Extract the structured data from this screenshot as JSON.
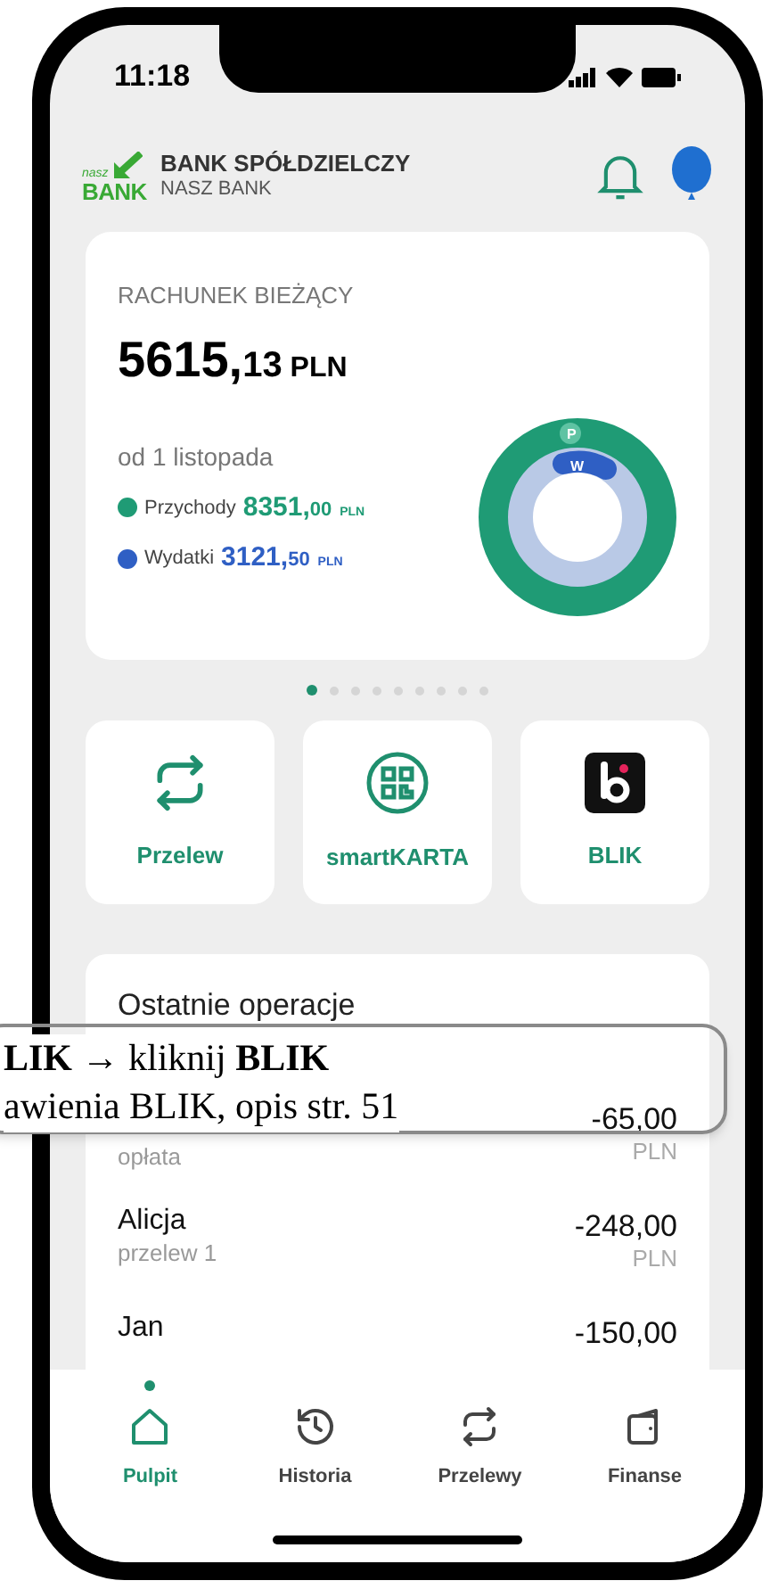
{
  "status_bar": {
    "time": "11:18"
  },
  "header": {
    "bank_logo_small": "nasz",
    "bank_logo_big": "BANK",
    "bank_name": "BANK SPÓŁDZIELCZY",
    "bank_subname": "NASZ BANK"
  },
  "account_card": {
    "title": "RACHUNEK BIEŻĄCY",
    "balance_main": "5615,",
    "balance_cents": "13",
    "balance_currency": "PLN",
    "period": "od 1 listopada",
    "legend": [
      {
        "label": "Przychody",
        "amount_main": "8351,",
        "amount_cents": "00",
        "currency": "PLN",
        "color": "#1f9b75"
      },
      {
        "label": "Wydatki",
        "amount_main": "3121,",
        "amount_cents": "50",
        "currency": "PLN",
        "color": "#2f5fc4"
      }
    ],
    "donut_labels": [
      "P",
      "W"
    ]
  },
  "carousel_dots": [
    {
      "selected": true
    },
    {
      "selected": false
    },
    {
      "selected": false
    },
    {
      "selected": false
    },
    {
      "selected": false
    },
    {
      "selected": false
    },
    {
      "selected": false
    },
    {
      "selected": false
    },
    {
      "selected": false
    }
  ],
  "tiles": [
    {
      "kind": "transfer",
      "label": "Przelew"
    },
    {
      "kind": "qr",
      "label": "smartKARTA"
    },
    {
      "kind": "blik",
      "label": "BLIK"
    }
  ],
  "operations": {
    "title": "Ostatnie operacje",
    "rows": [
      {
        "description": "opłata",
        "amount": "-65,00",
        "currency": "PLN"
      },
      {
        "name": "Alicja",
        "description": "przelew 1",
        "amount": "-248,00",
        "currency": "PLN"
      },
      {
        "name": "Jan",
        "amount": "-150,00"
      }
    ]
  },
  "callout": {
    "lines": [
      "**LIK** → kliknij **BLIK**",
      "awienia BLIK, opis str. 51"
    ]
  },
  "bottom_nav": [
    {
      "kind": "home",
      "label": "Pulpit",
      "selected": true
    },
    {
      "kind": "history",
      "label": "Historia",
      "selected": false
    },
    {
      "kind": "transfer",
      "label": "Przelewy",
      "selected": false
    },
    {
      "kind": "finance",
      "label": "Finanse",
      "selected": false
    }
  ]
}
